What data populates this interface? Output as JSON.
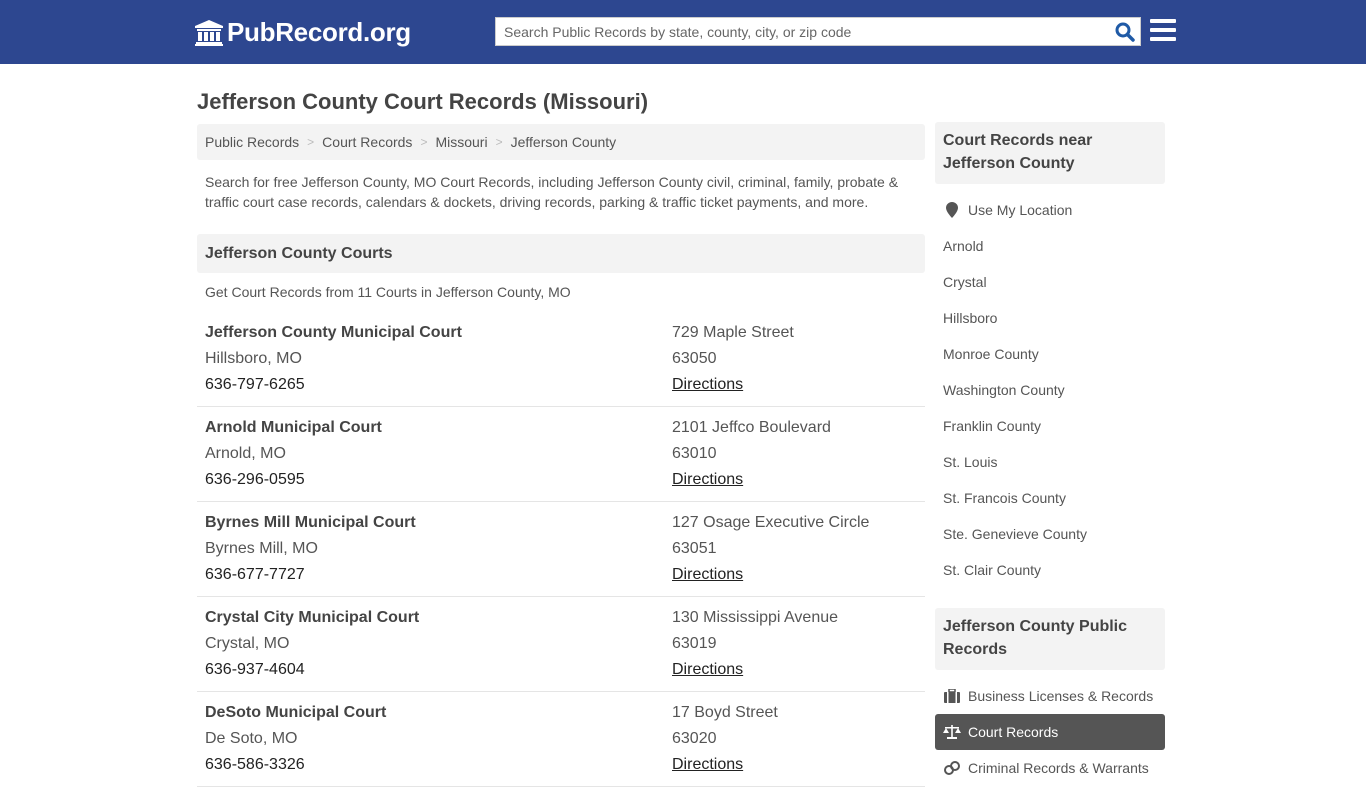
{
  "header": {
    "logo_text": "PubRecord.org",
    "search_placeholder": "Search Public Records by state, county, city, or zip code",
    "search_value": "",
    "brand_color": "#2d4790"
  },
  "page_title": "Jefferson County Court Records (Missouri)",
  "breadcrumb": [
    "Public Records",
    "Court Records",
    "Missouri",
    "Jefferson County"
  ],
  "intro": "Search for free Jefferson County, MO Court Records, including Jefferson County civil, criminal, family, probate & traffic court case records, calendars & dockets, driving records, parking & traffic ticket payments, and more.",
  "courts_section": {
    "title": "Jefferson County Courts",
    "subtitle": "Get Court Records from 11 Courts in Jefferson County, MO",
    "courts": [
      {
        "name": "Jefferson County Municipal Court",
        "city": "Hillsboro, MO",
        "phone": "636-797-6265",
        "address": "729 Maple Street",
        "zip": "63050",
        "link": "Directions"
      },
      {
        "name": "Arnold Municipal Court",
        "city": "Arnold, MO",
        "phone": "636-296-0595",
        "address": "2101 Jeffco Boulevard",
        "zip": "63010",
        "link": "Directions"
      },
      {
        "name": "Byrnes Mill Municipal Court",
        "city": "Byrnes Mill, MO",
        "phone": "636-677-7727",
        "address": "127 Osage Executive Circle",
        "zip": "63051",
        "link": "Directions"
      },
      {
        "name": "Crystal City Municipal Court",
        "city": "Crystal, MO",
        "phone": "636-937-4604",
        "address": "130 Mississippi Avenue",
        "zip": "63019",
        "link": "Directions"
      },
      {
        "name": "DeSoto Municipal Court",
        "city": "De Soto, MO",
        "phone": "636-586-3326",
        "address": "17 Boyd Street",
        "zip": "63020",
        "link": "Directions"
      }
    ]
  },
  "sidebar": {
    "nearby": {
      "title": "Court Records near Jefferson County",
      "use_location": "Use My Location",
      "items": [
        "Arnold",
        "Crystal",
        "Hillsboro",
        "Monroe County",
        "Washington County",
        "Franklin County",
        "St. Louis",
        "St. Francois County",
        "Ste. Genevieve County",
        "St. Clair County"
      ]
    },
    "public_records": {
      "title": "Jefferson County Public Records",
      "items": [
        {
          "label": "Business Licenses & Records",
          "icon": "briefcase-icon",
          "active": false
        },
        {
          "label": "Court Records",
          "icon": "scale-icon",
          "active": true
        },
        {
          "label": "Criminal Records & Warrants",
          "icon": "handcuffs-icon",
          "active": false
        }
      ]
    }
  }
}
